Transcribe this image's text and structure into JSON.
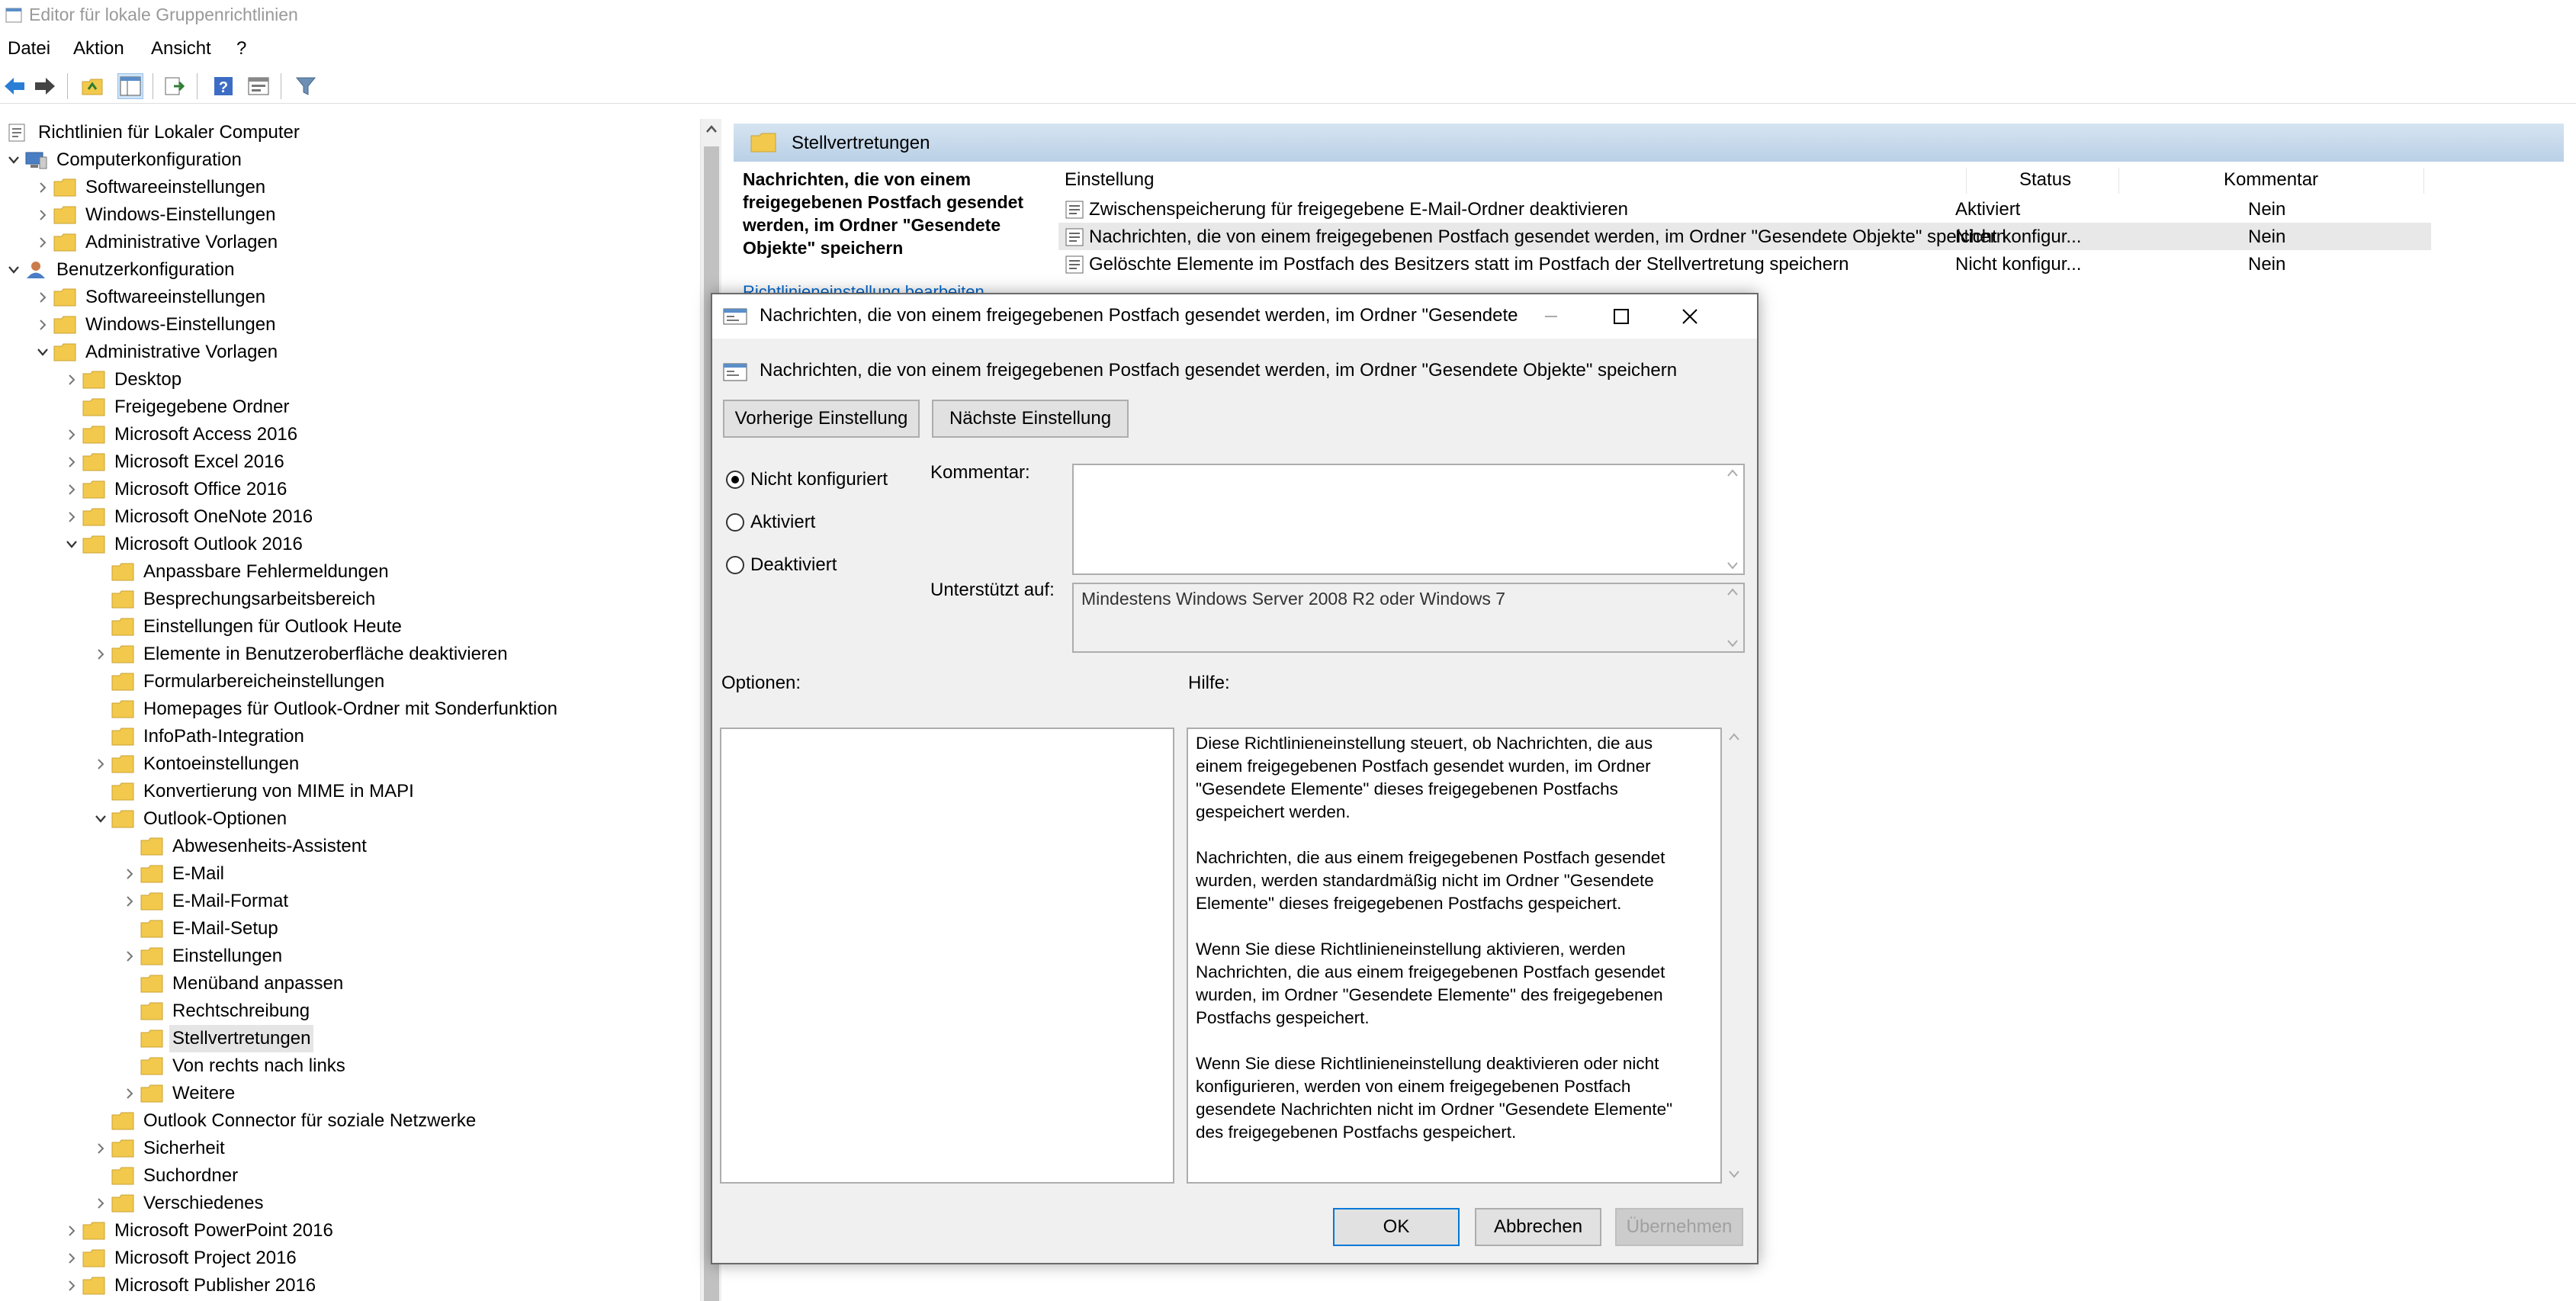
{
  "window": {
    "title": "Editor für lokale Gruppenrichtlinien"
  },
  "menu": [
    "Datei",
    "Aktion",
    "Ansicht",
    "?"
  ],
  "tree": [
    {
      "label": "Richtlinien für Lokaler Computer",
      "level": 0,
      "exp": "",
      "icon": "policy"
    },
    {
      "label": "Computerkonfiguration",
      "level": 0,
      "exp": "open",
      "icon": "computer"
    },
    {
      "label": "Softwareeinstellungen",
      "level": 1,
      "exp": "closed",
      "icon": "folder"
    },
    {
      "label": "Windows-Einstellungen",
      "level": 1,
      "exp": "closed",
      "icon": "folder"
    },
    {
      "label": "Administrative Vorlagen",
      "level": 1,
      "exp": "closed",
      "icon": "folder"
    },
    {
      "label": "Benutzerkonfiguration",
      "level": 0,
      "exp": "open",
      "icon": "user"
    },
    {
      "label": "Softwareeinstellungen",
      "level": 1,
      "exp": "closed",
      "icon": "folder"
    },
    {
      "label": "Windows-Einstellungen",
      "level": 1,
      "exp": "closed",
      "icon": "folder"
    },
    {
      "label": "Administrative Vorlagen",
      "level": 1,
      "exp": "open",
      "icon": "folder"
    },
    {
      "label": "Desktop",
      "level": 2,
      "exp": "closed",
      "icon": "folder"
    },
    {
      "label": "Freigegebene Ordner",
      "level": 2,
      "exp": "",
      "icon": "folder"
    },
    {
      "label": "Microsoft Access 2016",
      "level": 2,
      "exp": "closed",
      "icon": "folder"
    },
    {
      "label": "Microsoft Excel 2016",
      "level": 2,
      "exp": "closed",
      "icon": "folder"
    },
    {
      "label": "Microsoft Office 2016",
      "level": 2,
      "exp": "closed",
      "icon": "folder"
    },
    {
      "label": "Microsoft OneNote 2016",
      "level": 2,
      "exp": "closed",
      "icon": "folder"
    },
    {
      "label": "Microsoft Outlook 2016",
      "level": 2,
      "exp": "open",
      "icon": "folder"
    },
    {
      "label": "Anpassbare Fehlermeldungen",
      "level": 3,
      "exp": "",
      "icon": "folder"
    },
    {
      "label": "Besprechungsarbeitsbereich",
      "level": 3,
      "exp": "",
      "icon": "folder"
    },
    {
      "label": "Einstellungen für Outlook Heute",
      "level": 3,
      "exp": "",
      "icon": "folder"
    },
    {
      "label": "Elemente in Benutzeroberfläche deaktivieren",
      "level": 3,
      "exp": "closed",
      "icon": "folder"
    },
    {
      "label": "Formularbereicheinstellungen",
      "level": 3,
      "exp": "",
      "icon": "folder"
    },
    {
      "label": "Homepages für Outlook-Ordner mit Sonderfunktion",
      "level": 3,
      "exp": "",
      "icon": "folder"
    },
    {
      "label": "InfoPath-Integration",
      "level": 3,
      "exp": "",
      "icon": "folder"
    },
    {
      "label": "Kontoeinstellungen",
      "level": 3,
      "exp": "closed",
      "icon": "folder"
    },
    {
      "label": "Konvertierung von MIME in MAPI",
      "level": 3,
      "exp": "",
      "icon": "folder"
    },
    {
      "label": "Outlook-Optionen",
      "level": 3,
      "exp": "open",
      "icon": "folder"
    },
    {
      "label": "Abwesenheits-Assistent",
      "level": 4,
      "exp": "",
      "icon": "folder"
    },
    {
      "label": "E-Mail",
      "level": 4,
      "exp": "closed",
      "icon": "folder"
    },
    {
      "label": "E-Mail-Format",
      "level": 4,
      "exp": "closed",
      "icon": "folder"
    },
    {
      "label": "E-Mail-Setup",
      "level": 4,
      "exp": "",
      "icon": "folder"
    },
    {
      "label": "Einstellungen",
      "level": 4,
      "exp": "closed",
      "icon": "folder"
    },
    {
      "label": "Menüband anpassen",
      "level": 4,
      "exp": "",
      "icon": "folder"
    },
    {
      "label": "Rechtschreibung",
      "level": 4,
      "exp": "",
      "icon": "folder"
    },
    {
      "label": "Stellvertretungen",
      "level": 4,
      "exp": "",
      "icon": "folder",
      "selected": true
    },
    {
      "label": "Von rechts nach links",
      "level": 4,
      "exp": "",
      "icon": "folder"
    },
    {
      "label": "Weitere",
      "level": 4,
      "exp": "closed",
      "icon": "folder"
    },
    {
      "label": "Outlook Connector für soziale Netzwerke",
      "level": 3,
      "exp": "",
      "icon": "folder"
    },
    {
      "label": "Sicherheit",
      "level": 3,
      "exp": "closed",
      "icon": "folder"
    },
    {
      "label": "Suchordner",
      "level": 3,
      "exp": "",
      "icon": "folder"
    },
    {
      "label": "Verschiedenes",
      "level": 3,
      "exp": "closed",
      "icon": "folder"
    },
    {
      "label": "Microsoft PowerPoint 2016",
      "level": 2,
      "exp": "closed",
      "icon": "folder"
    },
    {
      "label": "Microsoft Project 2016",
      "level": 2,
      "exp": "closed",
      "icon": "folder"
    },
    {
      "label": "Microsoft Publisher 2016",
      "level": 2,
      "exp": "closed",
      "icon": "folder"
    }
  ],
  "right": {
    "header": "Stellvertretungen",
    "desc_title": "Nachrichten, die von einem freigegebenen Postfach gesendet werden, im Ordner \"Gesendete Objekte\" speichern",
    "desc_link": "Richtlinieneinstellung bearbeiten",
    "columns": {
      "setting": "Einstellung",
      "status": "Status",
      "comment": "Kommentar"
    },
    "rows": [
      {
        "name": "Zwischenspeicherung für freigegebene E-Mail-Ordner deaktivieren",
        "status": "Aktiviert",
        "comment": "Nein"
      },
      {
        "name": "Nachrichten, die von einem freigegebenen Postfach gesendet werden, im Ordner \"Gesendete Objekte\" speichern",
        "status": "Nicht konfigur...",
        "comment": "Nein",
        "selected": true
      },
      {
        "name": "Gelöschte Elemente im Postfach des Besitzers statt im Postfach der Stellvertretung speichern",
        "status": "Nicht konfigur...",
        "comment": "Nein"
      }
    ]
  },
  "dialog": {
    "title": "Nachrichten, die von einem freigegebenen Postfach gesendet werden, im Ordner \"Gesendete O...",
    "subtitle": "Nachrichten, die von einem freigegebenen Postfach gesendet werden, im Ordner \"Gesendete Objekte\" speichern",
    "prev_button": "Vorherige Einstellung",
    "next_button": "Nächste Einstellung",
    "radios": [
      {
        "label": "Nicht konfiguriert",
        "checked": true
      },
      {
        "label": "Aktiviert",
        "checked": false
      },
      {
        "label": "Deaktiviert",
        "checked": false
      }
    ],
    "comment_label": "Kommentar:",
    "comment_value": "",
    "supported_label": "Unterstützt auf:",
    "supported_value": "Mindestens Windows Server 2008 R2 oder Windows 7",
    "options_label": "Optionen:",
    "help_label": "Hilfe:",
    "help_text": "Diese Richtlinieneinstellung steuert, ob Nachrichten, die aus einem freigegebenen Postfach gesendet wurden, im Ordner \"Gesendete Elemente\" dieses freigegebenen Postfachs gespeichert werden.\n\nNachrichten, die aus einem freigegebenen Postfach gesendet wurden, werden standardmäßig nicht im Ordner \"Gesendete Elemente\" dieses freigegebenen Postfachs gespeichert.\n\nWenn Sie diese Richtlinieneinstellung aktivieren, werden Nachrichten, die aus einem freigegebenen Postfach gesendet wurden, im Ordner \"Gesendete Elemente\" des freigegebenen Postfachs gespeichert.\n\nWenn Sie diese Richtlinieneinstellung deaktivieren oder nicht konfigurieren, werden von einem freigegebenen Postfach gesendete Nachrichten nicht im Ordner \"Gesendete Elemente\" des freigegebenen Postfachs gespeichert.",
    "ok_button": "OK",
    "cancel_button": "Abbrechen",
    "apply_button": "Übernehmen"
  },
  "colors": {
    "accent": "#0078d7",
    "folder": "#f2c94c",
    "header_bg": "#c6d9ec"
  }
}
